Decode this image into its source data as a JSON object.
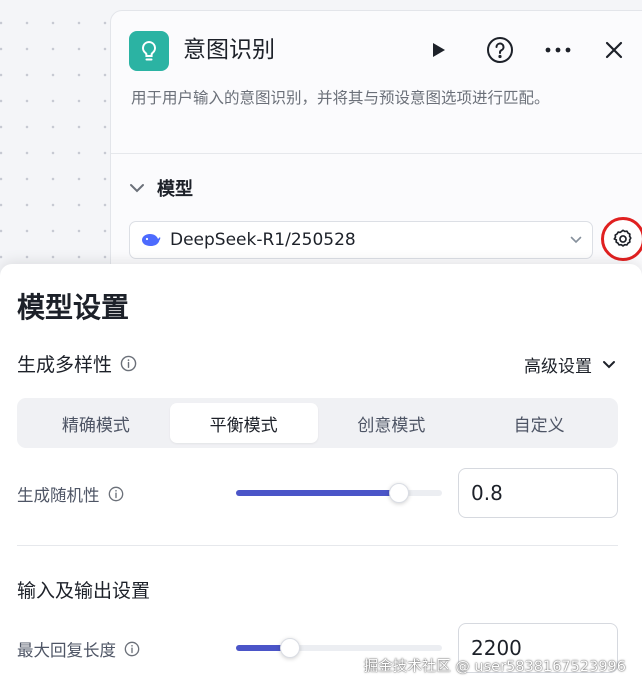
{
  "node": {
    "title": "意图识别",
    "description": "用于用户输入的意图识别，并将其与预设意图选项进行匹配。",
    "icon": "lightbulb-icon",
    "header_actions": [
      "play-icon",
      "help-icon",
      "more-icon",
      "close-icon"
    ]
  },
  "model_section": {
    "label": "模型",
    "selected_model": "DeepSeek-R1/250528",
    "model_icon": "whale-icon",
    "settings_icon": "gear-icon"
  },
  "settings": {
    "title": "模型设置",
    "diversity_label": "生成多样性",
    "advanced_label": "高级设置",
    "modes": [
      {
        "label": "精确模式",
        "active": false
      },
      {
        "label": "平衡模式",
        "active": true
      },
      {
        "label": "创意模式",
        "active": false
      },
      {
        "label": "自定义",
        "active": false
      }
    ],
    "randomness": {
      "label": "生成随机性",
      "value": "0.8",
      "slider_fraction": 0.79
    },
    "io_label": "输入及输出设置",
    "max_length": {
      "label": "最大回复长度",
      "value": "2200",
      "slider_fraction": 0.26
    }
  },
  "watermark": "掘金技术社区 @ user5838167523996",
  "colors": {
    "accent": "#4b55c8",
    "node_icon": "#2bb3a3",
    "highlight_ring": "#e02020"
  }
}
